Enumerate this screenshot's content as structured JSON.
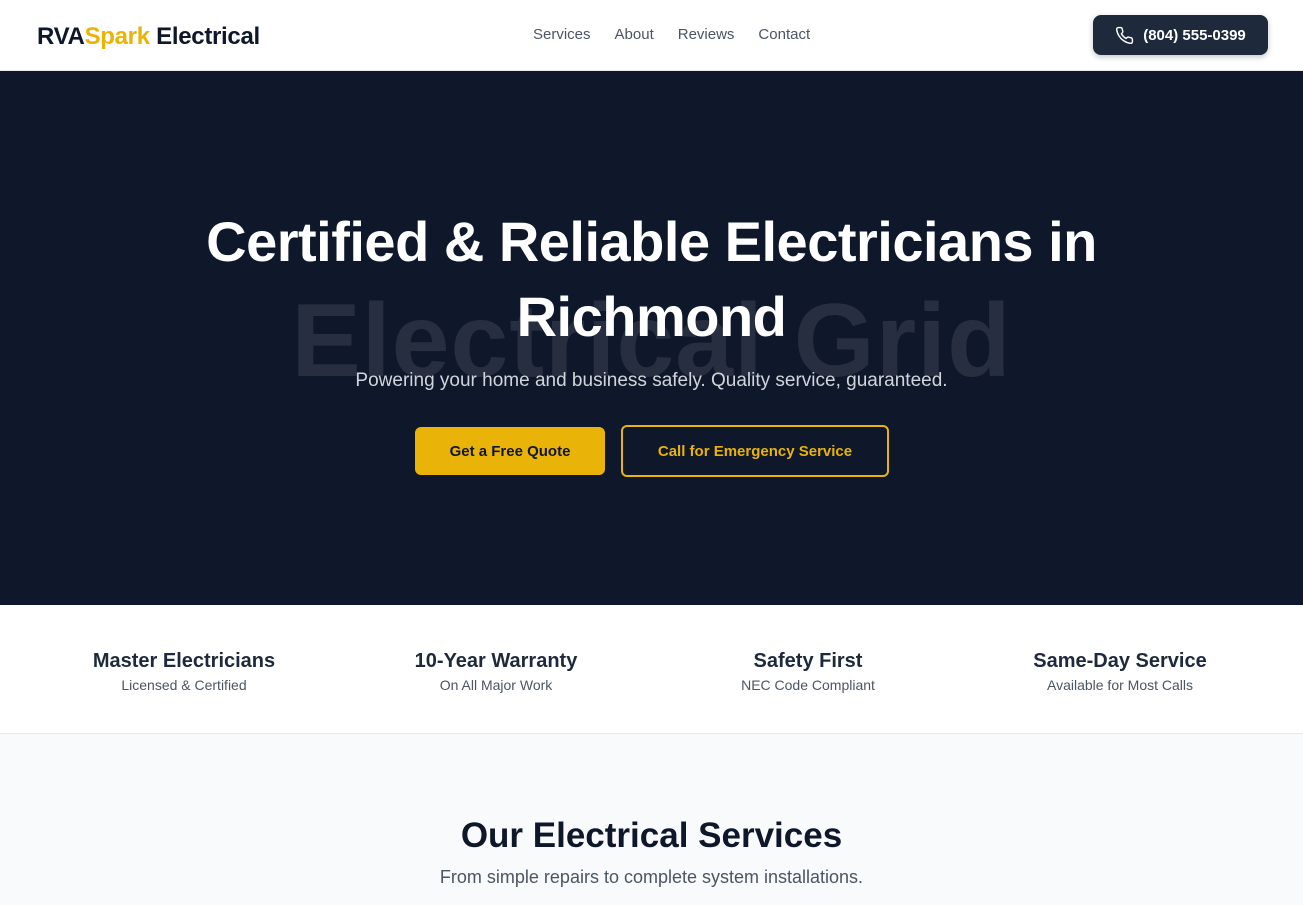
{
  "brand": {
    "prefix": "RVA",
    "accent": "Spark",
    "suffix": " Electrical",
    "accent_color": "#eab308"
  },
  "nav": {
    "items": [
      {
        "label": "Services"
      },
      {
        "label": "About"
      },
      {
        "label": "Reviews"
      },
      {
        "label": "Contact"
      }
    ]
  },
  "header": {
    "phone_label": "(804) 555-0399",
    "phone_icon": "phone-icon"
  },
  "hero": {
    "background_text": "Electrical Grid",
    "title": "Certified & Reliable Electricians in Richmond",
    "subtitle": "Powering your home and business safely. Quality service, guaranteed.",
    "primary_cta": "Get a Free Quote",
    "secondary_cta": "Call for Emergency Service",
    "background_color": "#0f172a"
  },
  "features": [
    {
      "title": "Master Electricians",
      "subtitle": "Licensed & Certified"
    },
    {
      "title": "10-Year Warranty",
      "subtitle": "On All Major Work"
    },
    {
      "title": "Safety First",
      "subtitle": "NEC Code Compliant"
    },
    {
      "title": "Same-Day Service",
      "subtitle": "Available for Most Calls"
    }
  ],
  "services": {
    "title": "Our Electrical Services",
    "subtitle": "From simple repairs to complete system installations."
  }
}
